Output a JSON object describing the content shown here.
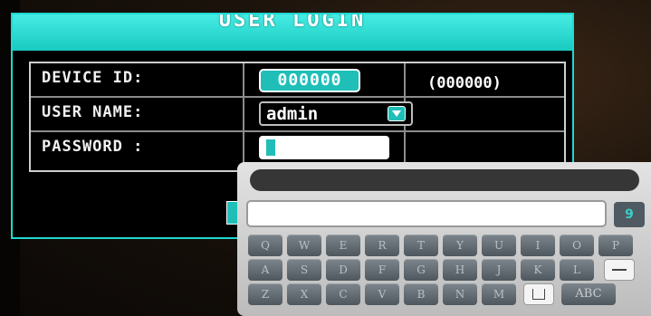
{
  "dialog": {
    "title": "USER LOGIN",
    "device_id": {
      "label": "DEVICE ID:",
      "value": "000000",
      "hint": "(000000)"
    },
    "user_name": {
      "label": "USER NAME:",
      "value": "admin"
    },
    "password": {
      "label": "PASSWORD :",
      "value": ""
    }
  },
  "keyboard": {
    "number_key": "9",
    "row1": [
      "Q",
      "W",
      "E",
      "R",
      "T",
      "Y",
      "U",
      "I",
      "O",
      "P"
    ],
    "row2": [
      "A",
      "S",
      "D",
      "F",
      "G",
      "H",
      "J",
      "K",
      "L"
    ],
    "row3": [
      "Z",
      "X",
      "C",
      "V",
      "B",
      "N",
      "M"
    ],
    "mode_key": "ABC",
    "enter_icon": "enter-dash-icon",
    "space_icon": "space-bracket-icon"
  },
  "colors": {
    "accent": "#1fd9d0",
    "background": "#000000",
    "keyboard": "#d0d0d0"
  }
}
